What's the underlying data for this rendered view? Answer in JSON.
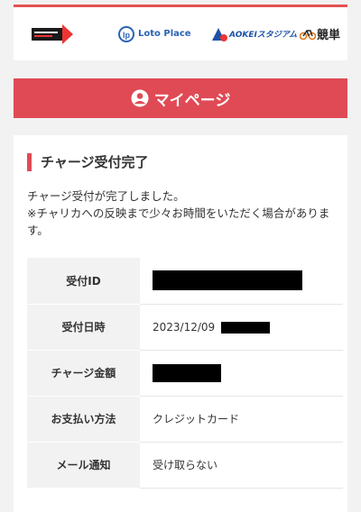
{
  "header": {
    "logos": [
      {
        "name": "dotline-logo",
        "text": ""
      },
      {
        "name": "loto-place-logo",
        "text": "Loto Place"
      },
      {
        "name": "aokei-stadium-logo",
        "text": "AOKEIスタジアム"
      },
      {
        "name": "keirin-logo",
        "text": "競単"
      }
    ]
  },
  "mypage": {
    "title": "マイページ",
    "icon": "user-circle-icon"
  },
  "section": {
    "title": "チャージ受付完了",
    "message_line1": "チャージ受付が完了しました。",
    "message_line2": "※チャリカへの反映まで少々お時間をいただく場合があります。"
  },
  "table": {
    "rows": [
      {
        "label": "受付ID",
        "value": ""
      },
      {
        "label": "受付日時",
        "value": "2023/12/09"
      },
      {
        "label": "チャージ金額",
        "value": ""
      },
      {
        "label": "お支払い方法",
        "value": "クレジットカード"
      },
      {
        "label": "メール通知",
        "value": "受け取らない"
      }
    ]
  },
  "colors": {
    "accent": "#e04a55",
    "header_line": "#e35353",
    "label_bg": "#f2f2f2"
  }
}
